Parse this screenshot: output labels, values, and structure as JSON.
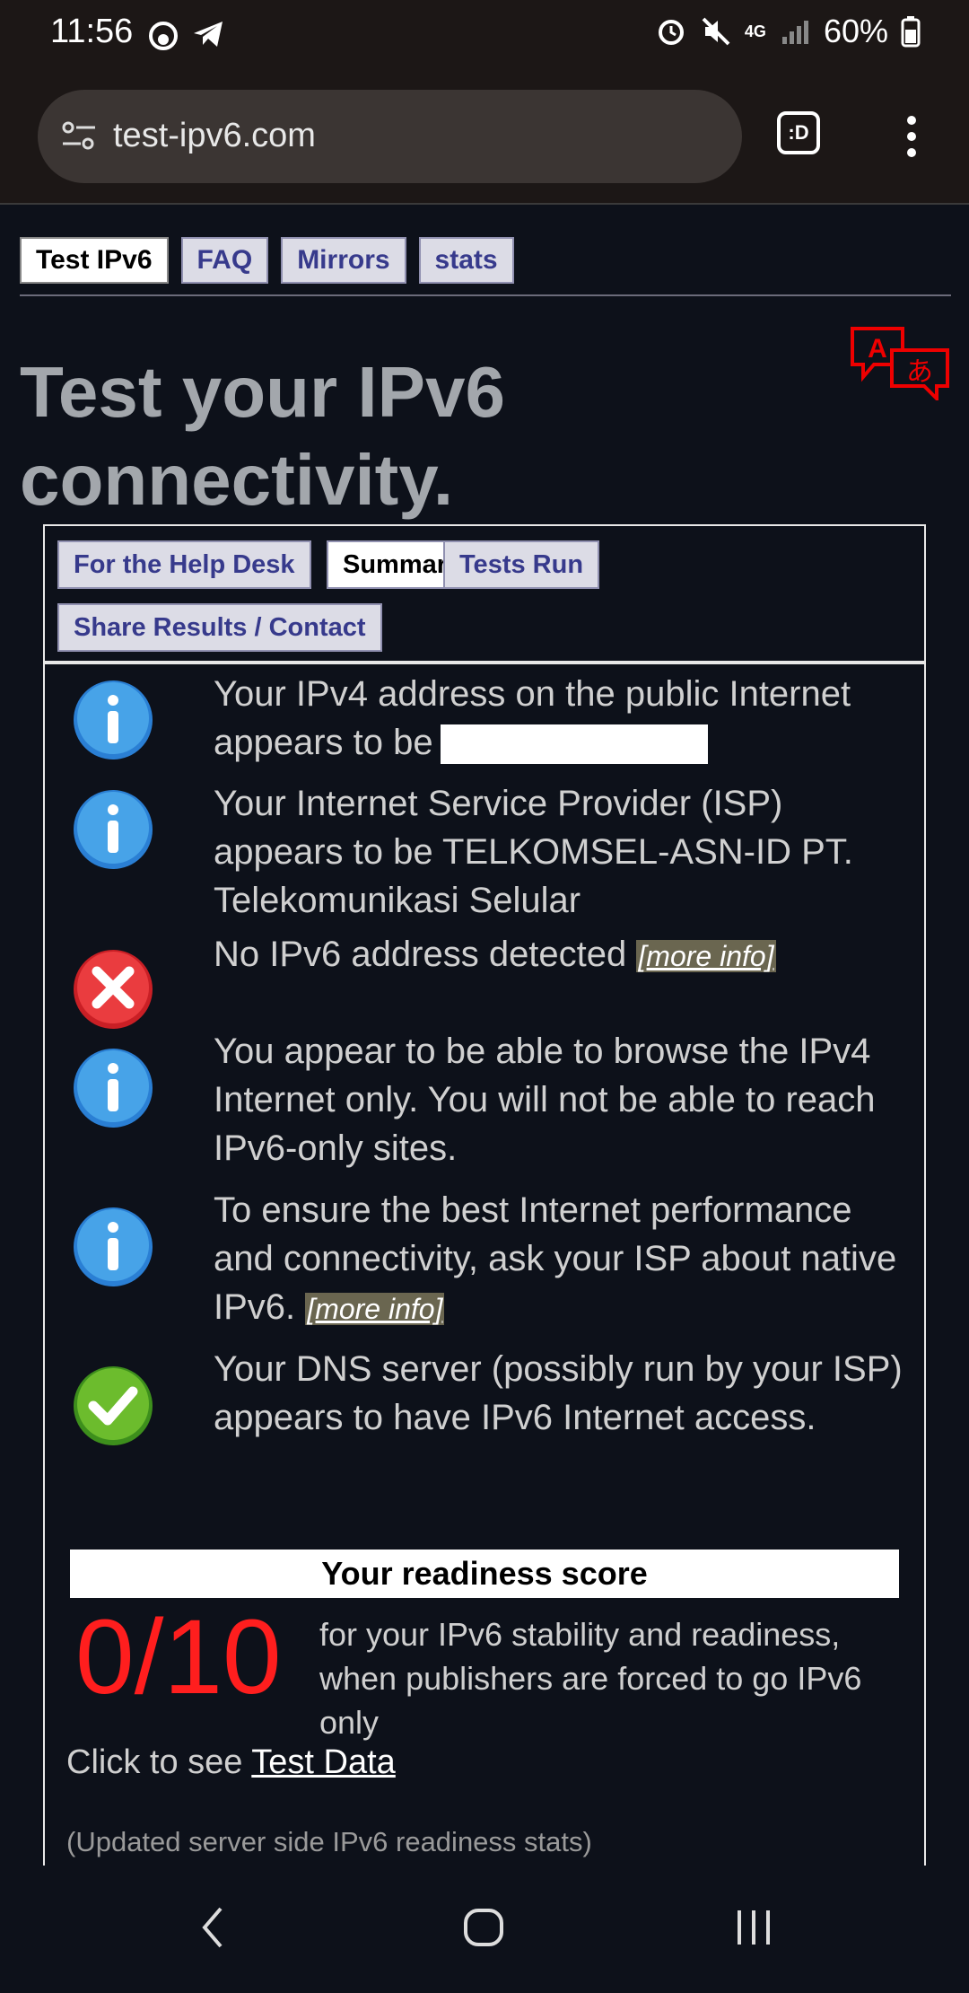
{
  "status": {
    "time": "11:56",
    "network": "4G",
    "battery": "60%"
  },
  "browser": {
    "url": "test-ipv6.com",
    "tab_label": ":D"
  },
  "nav": {
    "tabs": [
      "Test IPv6",
      "FAQ",
      "Mirrors",
      "stats"
    ]
  },
  "page": {
    "title": "Test your IPv6 connectivity."
  },
  "subtabs": [
    "For the Help Desk",
    "Summary",
    "Tests Run",
    "Share Results / Contact"
  ],
  "results": [
    {
      "icon": "info",
      "text": "Your IPv4 address on the public Internet appears to be"
    },
    {
      "icon": "info",
      "text": "Your Internet Service Provider (ISP) appears to be TELKOMSEL-ASN-ID PT. Telekomunikasi Selular"
    },
    {
      "icon": "error",
      "text": "No IPv6 address detected",
      "link": "[more info]"
    },
    {
      "icon": "info",
      "text": "You appear to be able to browse the IPv4 Internet only. You will not be able to reach IPv6-only sites."
    },
    {
      "icon": "info",
      "text": "To ensure the best Internet performance and connectivity, ask your ISP about native IPv6.",
      "link": "[more info]"
    },
    {
      "icon": "ok",
      "text": "Your DNS server (possibly run by your ISP) appears to have IPv6 Internet access."
    }
  ],
  "score": {
    "heading": "Your readiness score",
    "value": "0/10",
    "description": "for your IPv6 stability and readiness, when publishers are forced to go IPv6 only",
    "color": "#ff1e1e"
  },
  "footer": {
    "click_prefix": "Click to see",
    "click_link": "Test Data",
    "updated": "(Updated server side IPv6 readiness stats)"
  }
}
